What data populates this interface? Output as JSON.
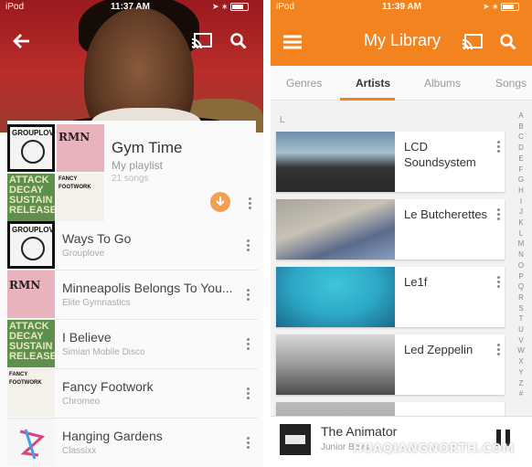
{
  "left": {
    "status": {
      "carrier": "iPod",
      "time": "11:37 AM"
    },
    "icons": {
      "back": "arrow-back-icon",
      "cast": "cast-icon",
      "search": "search-icon"
    },
    "playlist": {
      "title": "Gym Time",
      "subtitle": "My playlist",
      "count": "21 songs",
      "download_icon": "download-icon"
    },
    "tracks": [
      {
        "title": "Ways To Go",
        "artist": "Grouplove",
        "art": "GROUPLOVE"
      },
      {
        "title": "Minneapolis Belongs To You...",
        "artist": "Elite Gymnastics",
        "art": "RMN"
      },
      {
        "title": "I Believe",
        "artist": "Simian Mobile Disco",
        "art": "ATTACK DECAY SUSTAIN RELEASE"
      },
      {
        "title": "Fancy Footwork",
        "artist": "Chromeo",
        "art": "FANCY FOOTWORK"
      },
      {
        "title": "Hanging Gardens",
        "artist": "Classixx",
        "art": ""
      }
    ],
    "mosaic": {
      "a": "GROUPLOVE",
      "b": "RMN",
      "c": "ATTACK DECAY SUSTAIN RELEASE",
      "d": "FANCY FOOTWORK"
    }
  },
  "right": {
    "status": {
      "carrier": "iPod",
      "time": "11:39 AM"
    },
    "header": {
      "title": "My Library",
      "menu_icon": "menu-icon",
      "cast_icon": "cast-icon",
      "search_icon": "search-icon"
    },
    "tabs": [
      "Genres",
      "Artists",
      "Albums",
      "Songs"
    ],
    "active_tab": "Artists",
    "section_letter": "L",
    "artists": [
      "LCD Soundsystem",
      "Le Butcherettes",
      "Le1f",
      "Led Zeppelin",
      ""
    ],
    "az_index": [
      "A",
      "B",
      "C",
      "D",
      "E",
      "F",
      "G",
      "H",
      "I",
      "J",
      "K",
      "L",
      "M",
      "N",
      "O",
      "P",
      "Q",
      "R",
      "S",
      "T",
      "U",
      "V",
      "W",
      "X",
      "Y",
      "Z",
      "#"
    ],
    "now_playing": {
      "title": "The Animator",
      "artist": "Junior Boys",
      "pause_icon": "pause-icon"
    },
    "watermark": "HUAQIANGNORTH.COM"
  },
  "colors": {
    "accent": "#f3831f",
    "hero": "#b92d2a"
  }
}
